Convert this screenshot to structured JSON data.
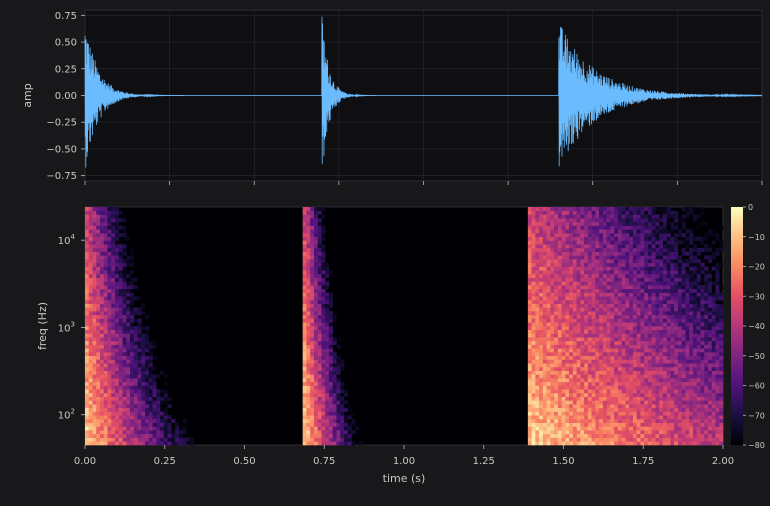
{
  "colors": {
    "figure_bg": "#18181b",
    "axes_bg": "#0f0f12",
    "grid": "#2a2a2e",
    "waveform": "#6bbcff",
    "text": "#c8c8c8",
    "colormap": "magma"
  },
  "chart_data": [
    {
      "type": "line",
      "panel": "waveform",
      "xlabel": "",
      "ylabel": "amp",
      "xlim": [
        0.0,
        2.0
      ],
      "ylim": [
        -0.8,
        0.8
      ],
      "yticks": [
        "0.75",
        "0.50",
        "0.25",
        "0.00",
        "−0.25",
        "−0.50",
        "−0.75"
      ],
      "ytick_values": [
        0.75,
        0.5,
        0.25,
        0.0,
        -0.25,
        -0.5,
        -0.75
      ],
      "xticks": [
        0,
        0.25,
        0.5,
        0.75,
        1.0,
        1.25,
        1.5,
        1.75,
        2.0
      ],
      "grid": true,
      "series": [
        {
          "events": [
            {
              "onset_s": 0.0,
              "peak_amp": 0.72,
              "decay_s": 0.13
            },
            {
              "onset_s": 0.7,
              "peak_amp": 0.77,
              "decay_s": 0.07
            },
            {
              "onset_s": 1.4,
              "peak_amp": 0.7,
              "decay_s": 0.35
            }
          ]
        }
      ]
    },
    {
      "type": "heatmap",
      "panel": "spectrogram",
      "xlabel": "time (s)",
      "ylabel": "freq (Hz)",
      "xlim": [
        0.0,
        2.0
      ],
      "yscale": "log",
      "ylim_hz": [
        45,
        24000
      ],
      "xticks": [
        "0.00",
        "0.25",
        "0.50",
        "0.75",
        "1.00",
        "1.25",
        "1.50",
        "1.75",
        "2.00"
      ],
      "xtick_values": [
        0,
        0.25,
        0.5,
        0.75,
        1.0,
        1.25,
        1.5,
        1.75,
        2.0
      ],
      "yticks": [
        "10^2",
        "10^3",
        "10^4"
      ],
      "ytick_values": [
        100,
        1000,
        10000
      ],
      "colorbar": {
        "range_db": [
          -80,
          0
        ],
        "ticks": [
          "0",
          "−10",
          "−20",
          "−30",
          "−40",
          "−50",
          "−60",
          "−70",
          "−80"
        ],
        "tick_values": [
          0,
          -10,
          -20,
          -30,
          -40,
          -50,
          -60,
          -70,
          -80
        ]
      },
      "events": [
        {
          "onset_s": 0.0,
          "decay_s": 0.14
        },
        {
          "onset_s": 0.69,
          "decay_s": 0.07
        },
        {
          "onset_s": 1.39,
          "decay_s": 0.6
        }
      ]
    }
  ]
}
